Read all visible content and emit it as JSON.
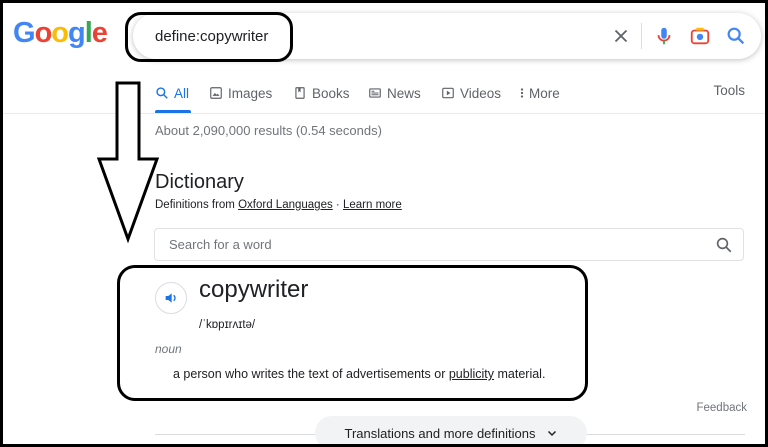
{
  "logo": {
    "letters": [
      "G",
      "o",
      "o",
      "g",
      "l",
      "e"
    ]
  },
  "search": {
    "query": "define:copywriter"
  },
  "icons": {
    "clear": "close-icon",
    "voice": "microphone-icon",
    "lens": "camera-icon",
    "search": "search-icon"
  },
  "tabs": [
    {
      "label": "All",
      "icon": "search-icon"
    },
    {
      "label": "Images",
      "icon": "image-icon"
    },
    {
      "label": "Books",
      "icon": "book-icon"
    },
    {
      "label": "News",
      "icon": "news-icon"
    },
    {
      "label": "Videos",
      "icon": "play-icon"
    },
    {
      "label": "More",
      "icon": "more-vert-icon"
    }
  ],
  "tools_label": "Tools",
  "stats": "About 2,090,000 results (0.54 seconds)",
  "dictionary": {
    "title": "Dictionary",
    "source_prefix": "Definitions from",
    "source_link": "Oxford Languages",
    "separator": "·",
    "learn_more": "Learn more",
    "search_placeholder": "Search for a word"
  },
  "entry": {
    "word": "copywriter",
    "phonetic": "/ˈkɒpɪrʌɪtə/",
    "part_of_speech": "noun",
    "definition_before": "a person who writes the text of advertisements or",
    "definition_link": "publicity",
    "definition_after": "material."
  },
  "feedback_label": "Feedback",
  "translations_label": "Translations and more definitions",
  "colors": {
    "accent": "#1a73e8",
    "annotation": "#000000"
  }
}
